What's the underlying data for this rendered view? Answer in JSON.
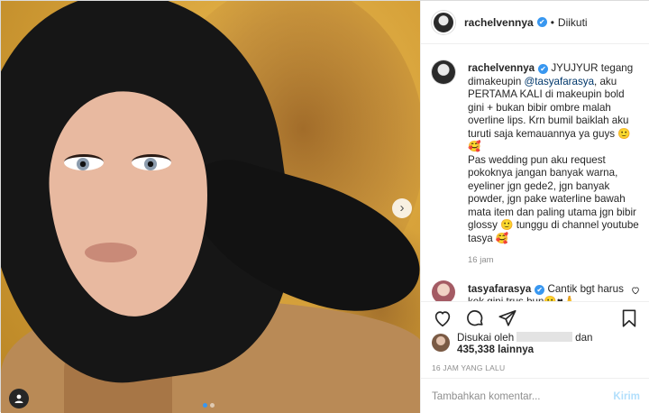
{
  "post": {
    "username": "rachelvennya",
    "verified_glyph": "✔",
    "separator": "•",
    "follow_status": "Diikuti",
    "next_glyph": "›"
  },
  "caption": {
    "username": "rachelvennya",
    "text_before_mention": " JYUJYUR tegang dimakeupin ",
    "mention": "@tasyafarasya",
    "text_after_mention": ", aku PERTAMA KALI di makeupin bold gini + bukan bibir ombre malah overline lips. Krn bumil baiklah aku turuti saja kemauannya ya guys 🙂🥰\nPas wedding pun aku request pokoknya jangan banyak warna, eyeliner jgn gede2, jgn banyak powder, jgn pake waterline bawah mata item dan paling utama jgn bibir glossy 🙂 tunggu di channel youtube tasya 🥰",
    "time": "16 jam"
  },
  "comment": {
    "username": "tasyafarasya",
    "text": " Cantik bgt harus kek gini trus bun🙂♥🙏"
  },
  "likes": {
    "prefix": "Disukai oleh",
    "suffix": "dan",
    "count": "435,338",
    "count_suffix": " lainnya"
  },
  "post_time": "16 JAM YANG LALU",
  "comment_bar": {
    "placeholder": "Tambahkan komentar...",
    "post_label": "Kirim"
  },
  "icons": {
    "heart": "heart-icon",
    "comment": "comment-icon",
    "share": "share-icon",
    "save": "bookmark-icon",
    "tag": "person-tag-icon"
  },
  "colors": {
    "verified": "#3897f0",
    "link": "#00376b",
    "muted": "#8e8e8e",
    "post_button_disabled": "#b2dffc"
  }
}
